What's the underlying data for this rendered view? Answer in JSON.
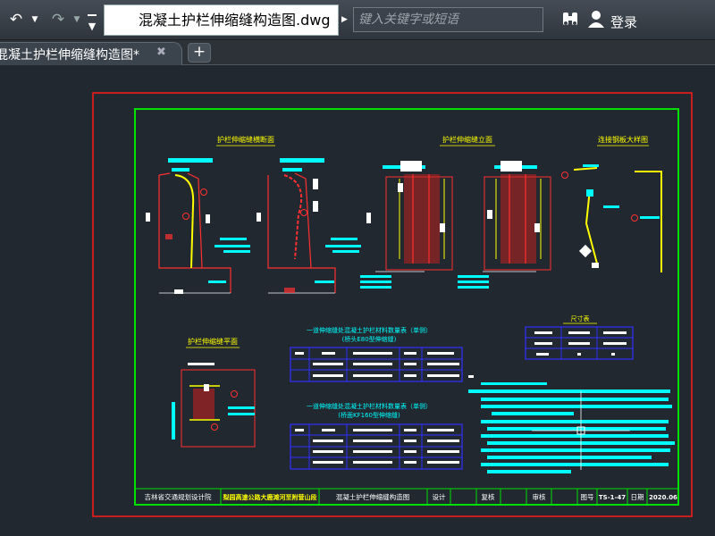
{
  "toolbar": {
    "file_name": "混凝土护栏伸缩缝构造图.dwg",
    "search_placeholder": "键入关键字或短语",
    "login_label": "登录"
  },
  "tabs": [
    {
      "label": "混凝土护栏伸缩缝构造图*"
    }
  ],
  "drawing": {
    "titles": {
      "section_view": "护栏伸缩缝横断面",
      "elevation_view": "护栏伸缩缝立面",
      "large_detail": "连接钢板大样图",
      "plan_view": "护栏伸缩缝平面",
      "table1_title": "一道伸缩缝处混凝土护栏材料数量表（单侧）",
      "table1_subtitle": "(桥头E80型伸缩缝)",
      "table2_title": "一道伸缩缝处混凝土护栏材料数量表（单侧）",
      "table2_subtitle": "(桥面KF160型伸缩缝)",
      "dim_table_title": "尺寸表"
    },
    "title_block": {
      "institute": "吉林省交通规划设计院",
      "project": "梨园高速公路大鹿滩河至附营山段",
      "drawing_name": "混凝土护栏伸缩缝构造图",
      "design": "设计",
      "review": "复核",
      "approve": "审核",
      "drawing_no_label": "图号",
      "drawing_no": "TS-1-47",
      "date_label": "日期",
      "date": "2020.06"
    }
  }
}
